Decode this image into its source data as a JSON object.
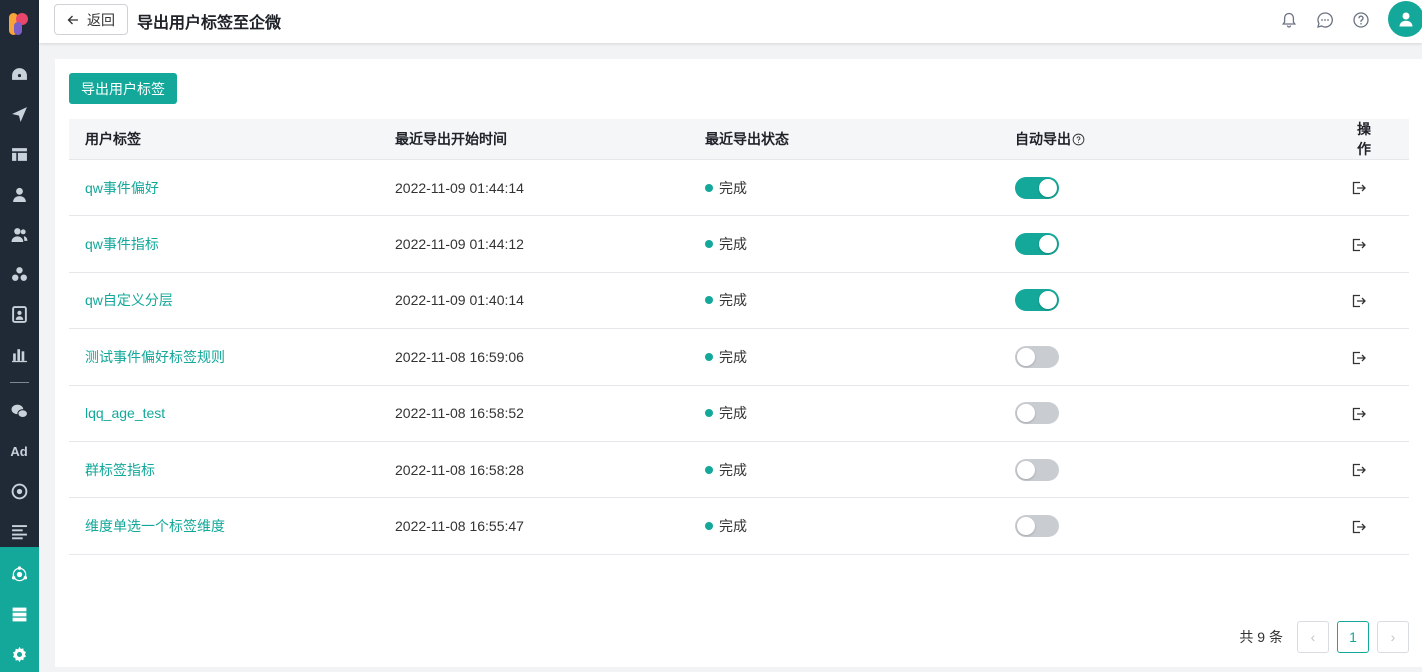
{
  "header": {
    "back_label": "返回",
    "title": "导出用户标签至企微"
  },
  "sidebar": {
    "items": [
      {
        "icon": "dashboard-icon"
      },
      {
        "icon": "send-icon"
      },
      {
        "icon": "layout-icon"
      },
      {
        "icon": "user-icon"
      },
      {
        "icon": "users-icon"
      },
      {
        "icon": "cluster-icon"
      },
      {
        "icon": "contact-card-icon"
      },
      {
        "icon": "bar-chart-icon"
      },
      {
        "icon": "wechat-icon"
      },
      {
        "label": "Ad"
      },
      {
        "icon": "target-icon"
      },
      {
        "icon": "list-icon"
      },
      {
        "icon": "hub-icon"
      },
      {
        "icon": "server-icon"
      },
      {
        "icon": "settings-icon"
      }
    ]
  },
  "toolbar": {
    "export_button": "导出用户标签"
  },
  "table": {
    "columns": [
      "用户标签",
      "最近导出开始时间",
      "最近导出状态",
      "自动导出",
      "操作"
    ],
    "rows": [
      {
        "name": "qw事件偏好",
        "time": "2022-11-09 01:44:14",
        "status": "完成",
        "auto": true
      },
      {
        "name": "qw事件指标",
        "time": "2022-11-09 01:44:12",
        "status": "完成",
        "auto": true
      },
      {
        "name": "qw自定义分层",
        "time": "2022-11-09 01:40:14",
        "status": "完成",
        "auto": true
      },
      {
        "name": "测试事件偏好标签规则",
        "time": "2022-11-08 16:59:06",
        "status": "完成",
        "auto": false
      },
      {
        "name": "lqq_age_test",
        "time": "2022-11-08 16:58:52",
        "status": "完成",
        "auto": false
      },
      {
        "name": "群标签指标",
        "time": "2022-11-08 16:58:28",
        "status": "完成",
        "auto": false
      },
      {
        "name": "维度单选一个标签维度",
        "time": "2022-11-08 16:55:47",
        "status": "完成",
        "auto": false
      }
    ]
  },
  "pagination": {
    "total_text": "共 9 条",
    "current_page": "1",
    "prev": "‹",
    "next": "›"
  },
  "colors": {
    "accent": "#13a89a",
    "sidebar_bg": "#1f2a36",
    "switch_off": "#c9cdd2"
  }
}
